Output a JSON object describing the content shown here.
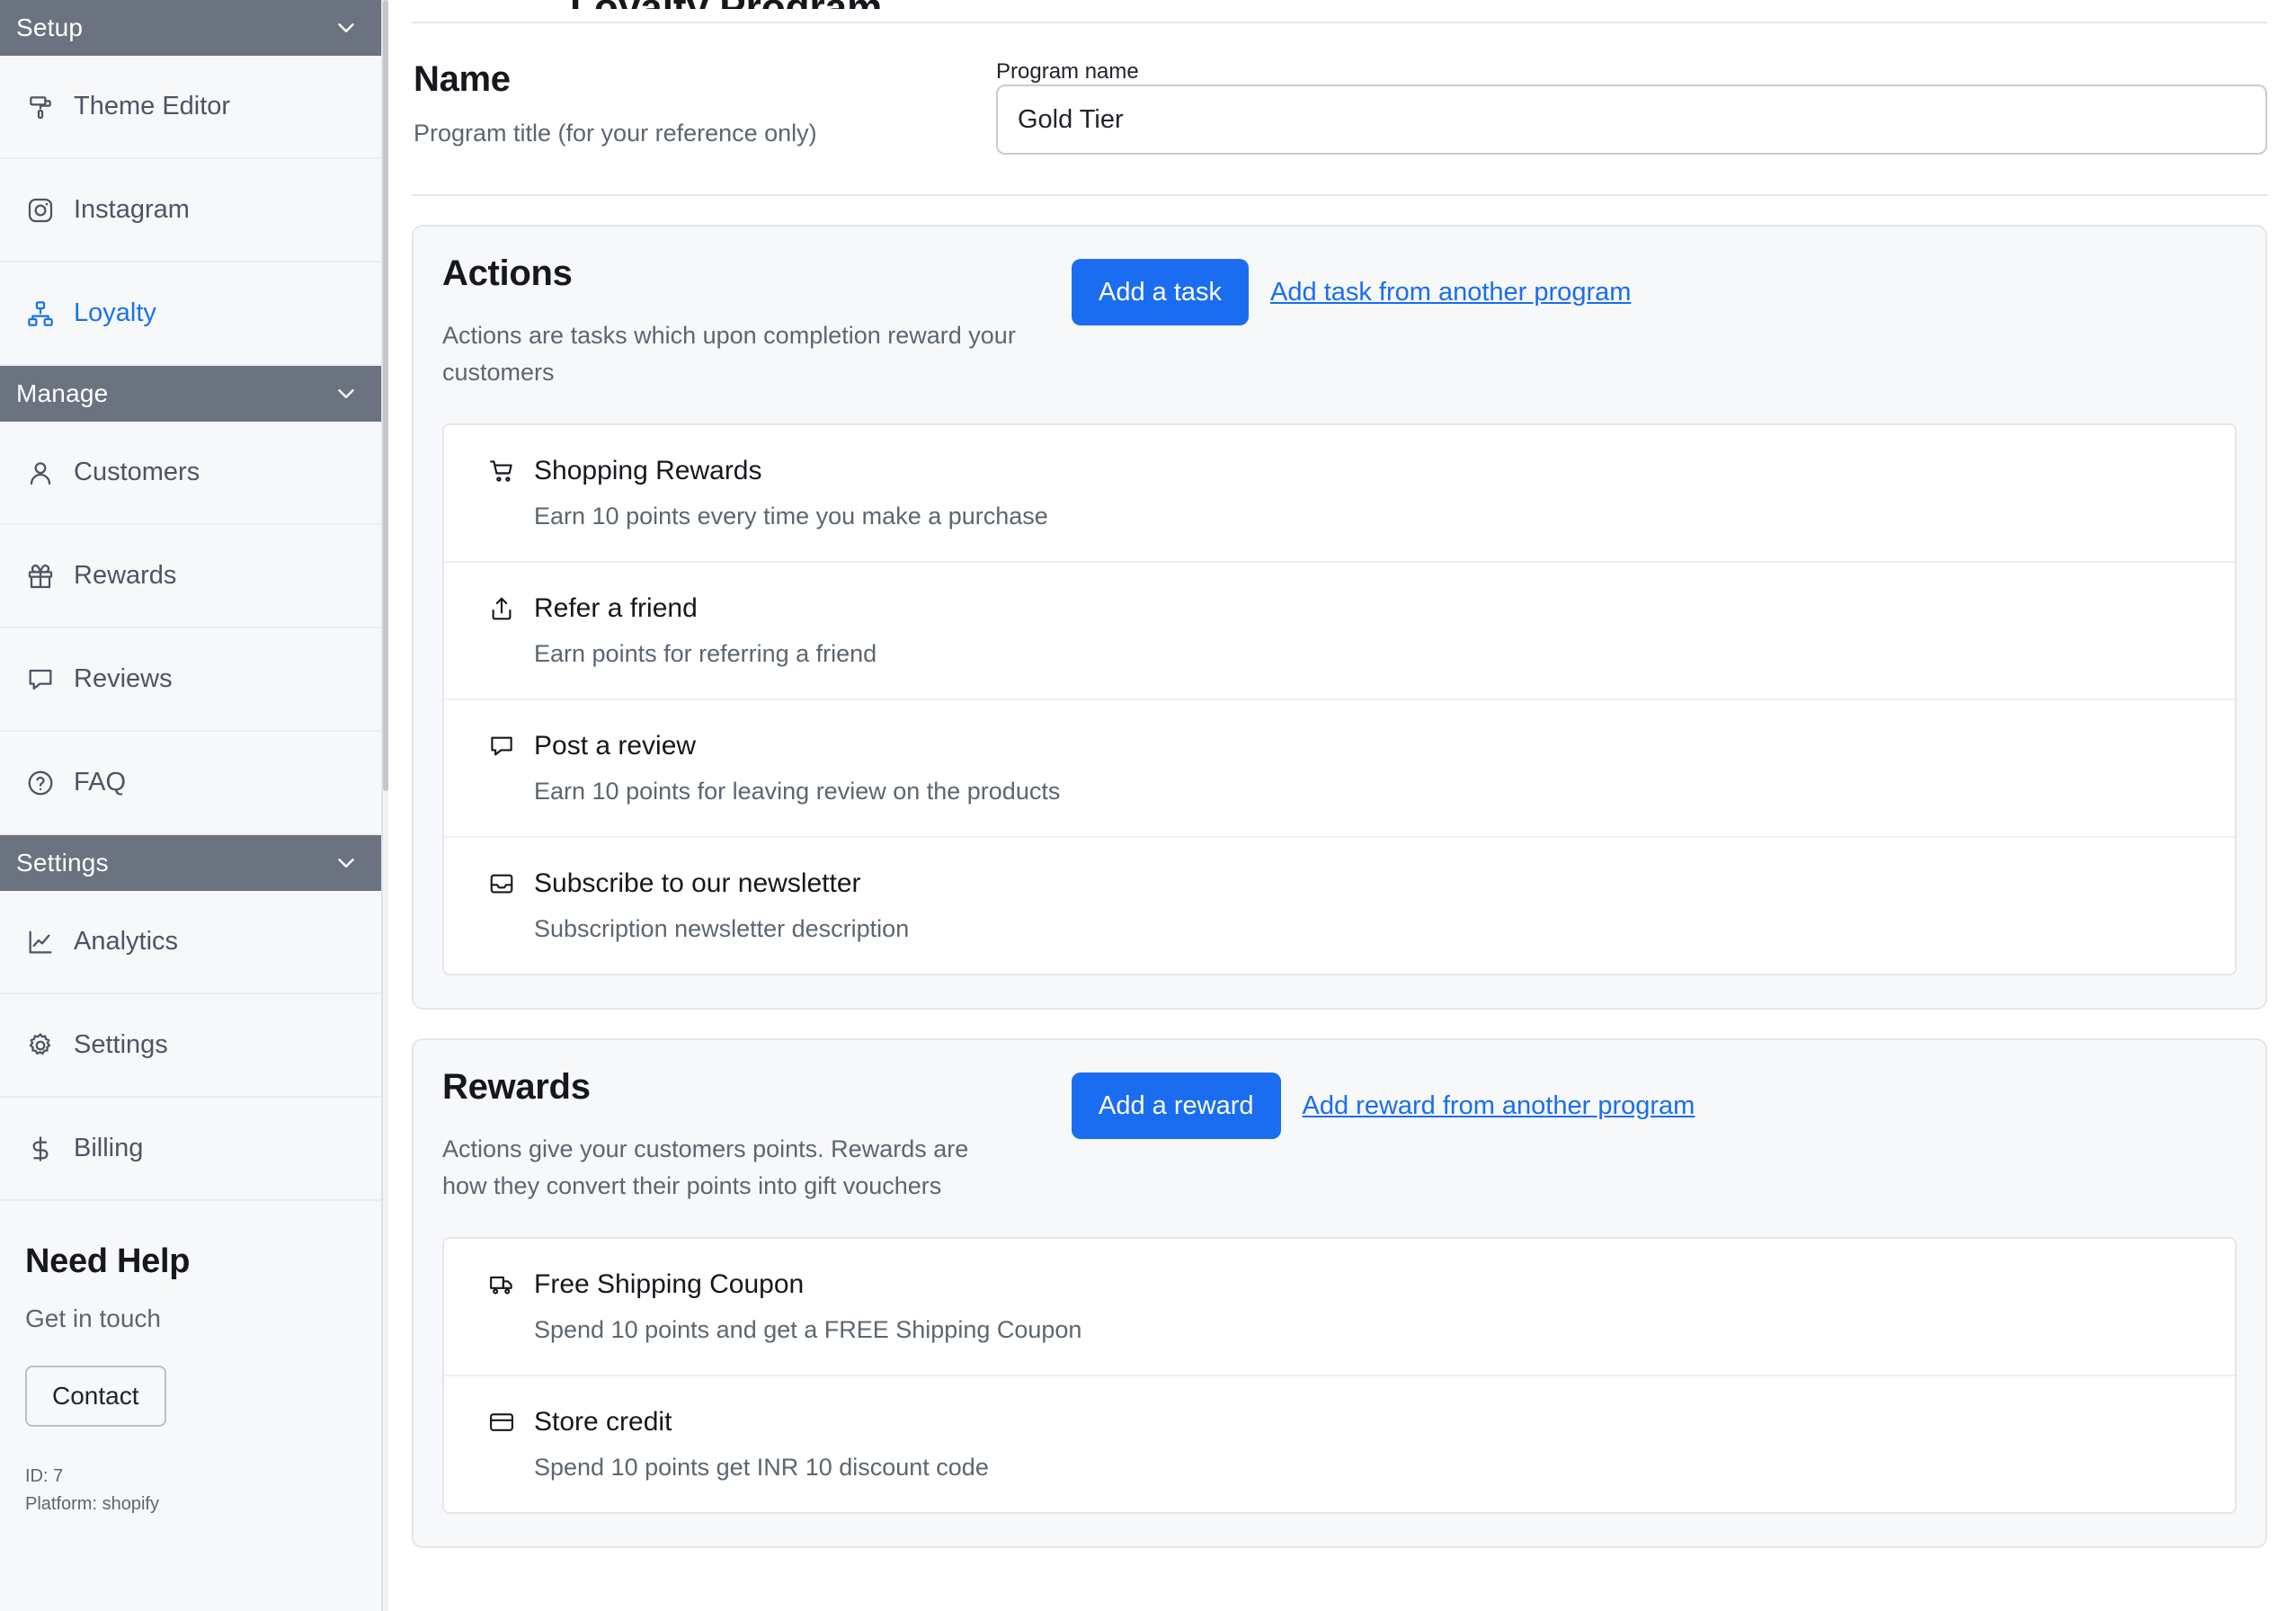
{
  "sidebar": {
    "groups": [
      {
        "label": "Setup",
        "icon": "chevron-down-icon",
        "items": [
          {
            "label": "Theme Editor",
            "icon": "paint-roller-icon",
            "active": false
          },
          {
            "label": "Instagram",
            "icon": "instagram-icon",
            "active": false
          },
          {
            "label": "Loyalty",
            "icon": "sitemap-icon",
            "active": true
          }
        ]
      },
      {
        "label": "Manage",
        "icon": "chevron-down-icon",
        "items": [
          {
            "label": "Customers",
            "icon": "user-icon",
            "active": false
          },
          {
            "label": "Rewards",
            "icon": "gift-icon",
            "active": false
          },
          {
            "label": "Reviews",
            "icon": "chat-bubble-icon",
            "active": false
          },
          {
            "label": "FAQ",
            "icon": "question-circle-icon",
            "active": false
          }
        ]
      },
      {
        "label": "Settings",
        "icon": "chevron-down-icon",
        "items": [
          {
            "label": "Analytics",
            "icon": "line-chart-icon",
            "active": false
          },
          {
            "label": "Settings",
            "icon": "gear-icon",
            "active": false
          },
          {
            "label": "Billing",
            "icon": "dollar-icon",
            "active": false
          }
        ]
      }
    ],
    "help": {
      "title": "Need Help",
      "subtitle": "Get in touch",
      "contact_label": "Contact",
      "id_line": "ID: 7",
      "platform_line": "Platform: shopify"
    }
  },
  "main": {
    "cut_off_title": "Loyalty Program",
    "name_section": {
      "heading": "Name",
      "description": "Program title (for your reference only)",
      "field_label": "Program name",
      "field_value": "Gold Tier",
      "field_placeholder": "Program name"
    },
    "actions_section": {
      "title": "Actions",
      "description": "Actions are tasks which upon completion reward your customers",
      "primary_button": "Add a task",
      "secondary_link": "Add task from another program",
      "items": [
        {
          "icon": "shopping-cart-icon",
          "title": "Shopping Rewards",
          "description": "Earn 10 points every time you make a purchase"
        },
        {
          "icon": "share-upload-icon",
          "title": "Refer a friend",
          "description": "Earn points for referring a friend"
        },
        {
          "icon": "chat-bubble-icon",
          "title": "Post a review",
          "description": "Earn 10 points for leaving review on the products"
        },
        {
          "icon": "inbox-icon",
          "title": "Subscribe to our newsletter",
          "description": "Subscription newsletter description"
        }
      ]
    },
    "rewards_section": {
      "title": "Rewards",
      "description": "Actions give your customers points. Rewards are how they convert their points into gift vouchers",
      "primary_button": "Add a reward",
      "secondary_link": "Add reward from another program",
      "items": [
        {
          "icon": "truck-icon",
          "title": "Free Shipping Coupon",
          "description": "Spend 10 points and get a FREE Shipping Coupon"
        },
        {
          "icon": "credit-card-icon",
          "title": "Store credit",
          "description": "Spend 10 points get INR 10 discount code"
        }
      ]
    }
  },
  "colors": {
    "accent_blue": "#1a6df0",
    "link_blue": "#1a73e8",
    "group_header_gray": "#6b7280",
    "panel_bg": "#f7f8fa"
  }
}
